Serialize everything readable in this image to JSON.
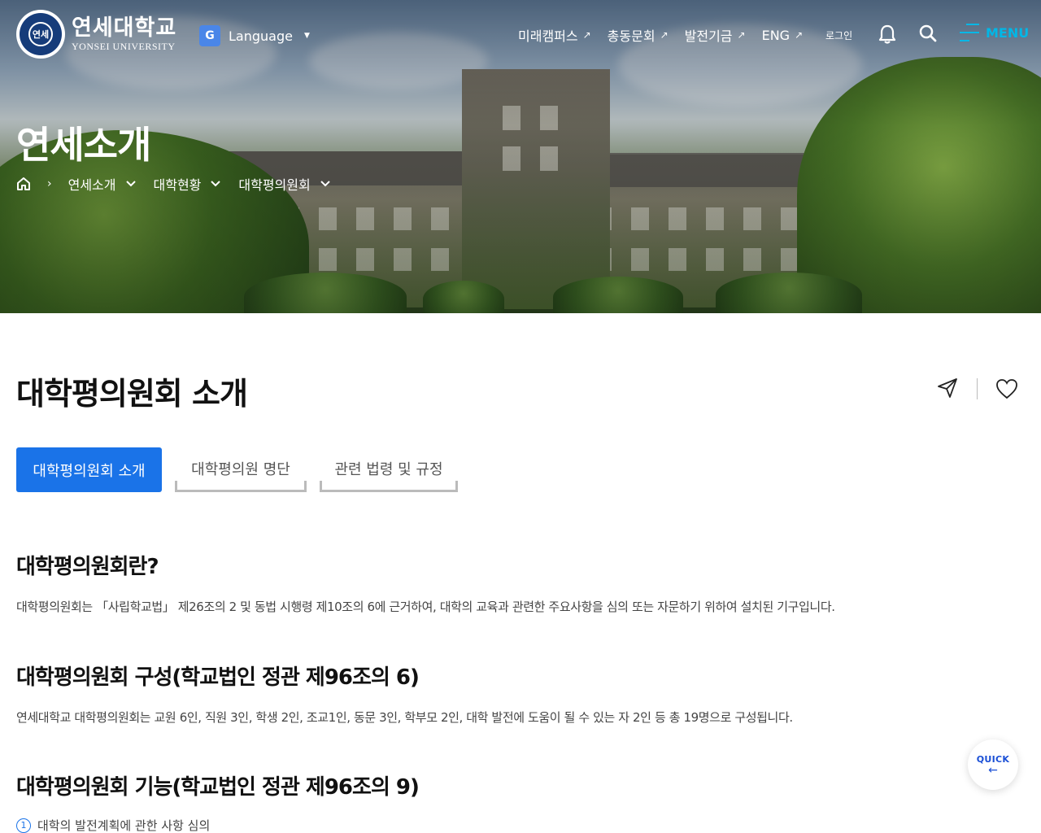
{
  "header": {
    "logo": {
      "title_ko": "연세대학교",
      "title_en": "YONSEI UNIVERSITY",
      "seal_text": "연세"
    },
    "language": {
      "label": "Language",
      "icon": "google-translate-icon"
    },
    "nav": [
      {
        "label": "미래캠퍼스",
        "icon": "external-link-icon"
      },
      {
        "label": "총동문회",
        "icon": "external-link-icon"
      },
      {
        "label": "발전기금",
        "icon": "external-link-icon"
      },
      {
        "label": "ENG",
        "icon": "external-link-icon"
      }
    ],
    "login_label": "로그인",
    "menu_label": "MENU"
  },
  "hero": {
    "title": "연세소개",
    "breadcrumb": [
      "연세소개",
      "대학현황",
      "대학평의원회"
    ]
  },
  "main": {
    "page_title": "대학평의원회 소개",
    "tabs": [
      {
        "label": "대학평의원회 소개",
        "active": true
      },
      {
        "label": "대학평의원 명단",
        "active": false
      },
      {
        "label": "관련 법령 및 규정",
        "active": false
      }
    ],
    "sections": [
      {
        "heading": "대학평의원회란?",
        "body": "대학평의원회는 「사립학교법」 제26조의 2 및 동법 시행령 제10조의 6에 근거하여, 대학의 교육과 관련한 주요사항을 심의 또는 자문하기 위하여 설치된 기구입니다."
      },
      {
        "heading": "대학평의원회 구성(학교법인 정관 제96조의 6)",
        "body": "연세대학교 대학평의원회는 교원 6인, 직원 3인, 학생 2인, 조교1인, 동문 3인, 학부모 2인, 대학 발전에 도움이 될 수 있는 자 2인 등 총 19명으로 구성됩니다."
      },
      {
        "heading": "대학평의원회 기능(학교법인 정관 제96조의 9)",
        "items": [
          {
            "num": "1",
            "text": "대학의 발전계획에 관한 사항 심의"
          }
        ]
      }
    ]
  },
  "quick": {
    "label": "QUICK",
    "arrow": "←"
  },
  "colors": {
    "primary": "#1a73e8",
    "menu_accent": "#00b7e6",
    "quick_text": "#1a4fd6"
  }
}
